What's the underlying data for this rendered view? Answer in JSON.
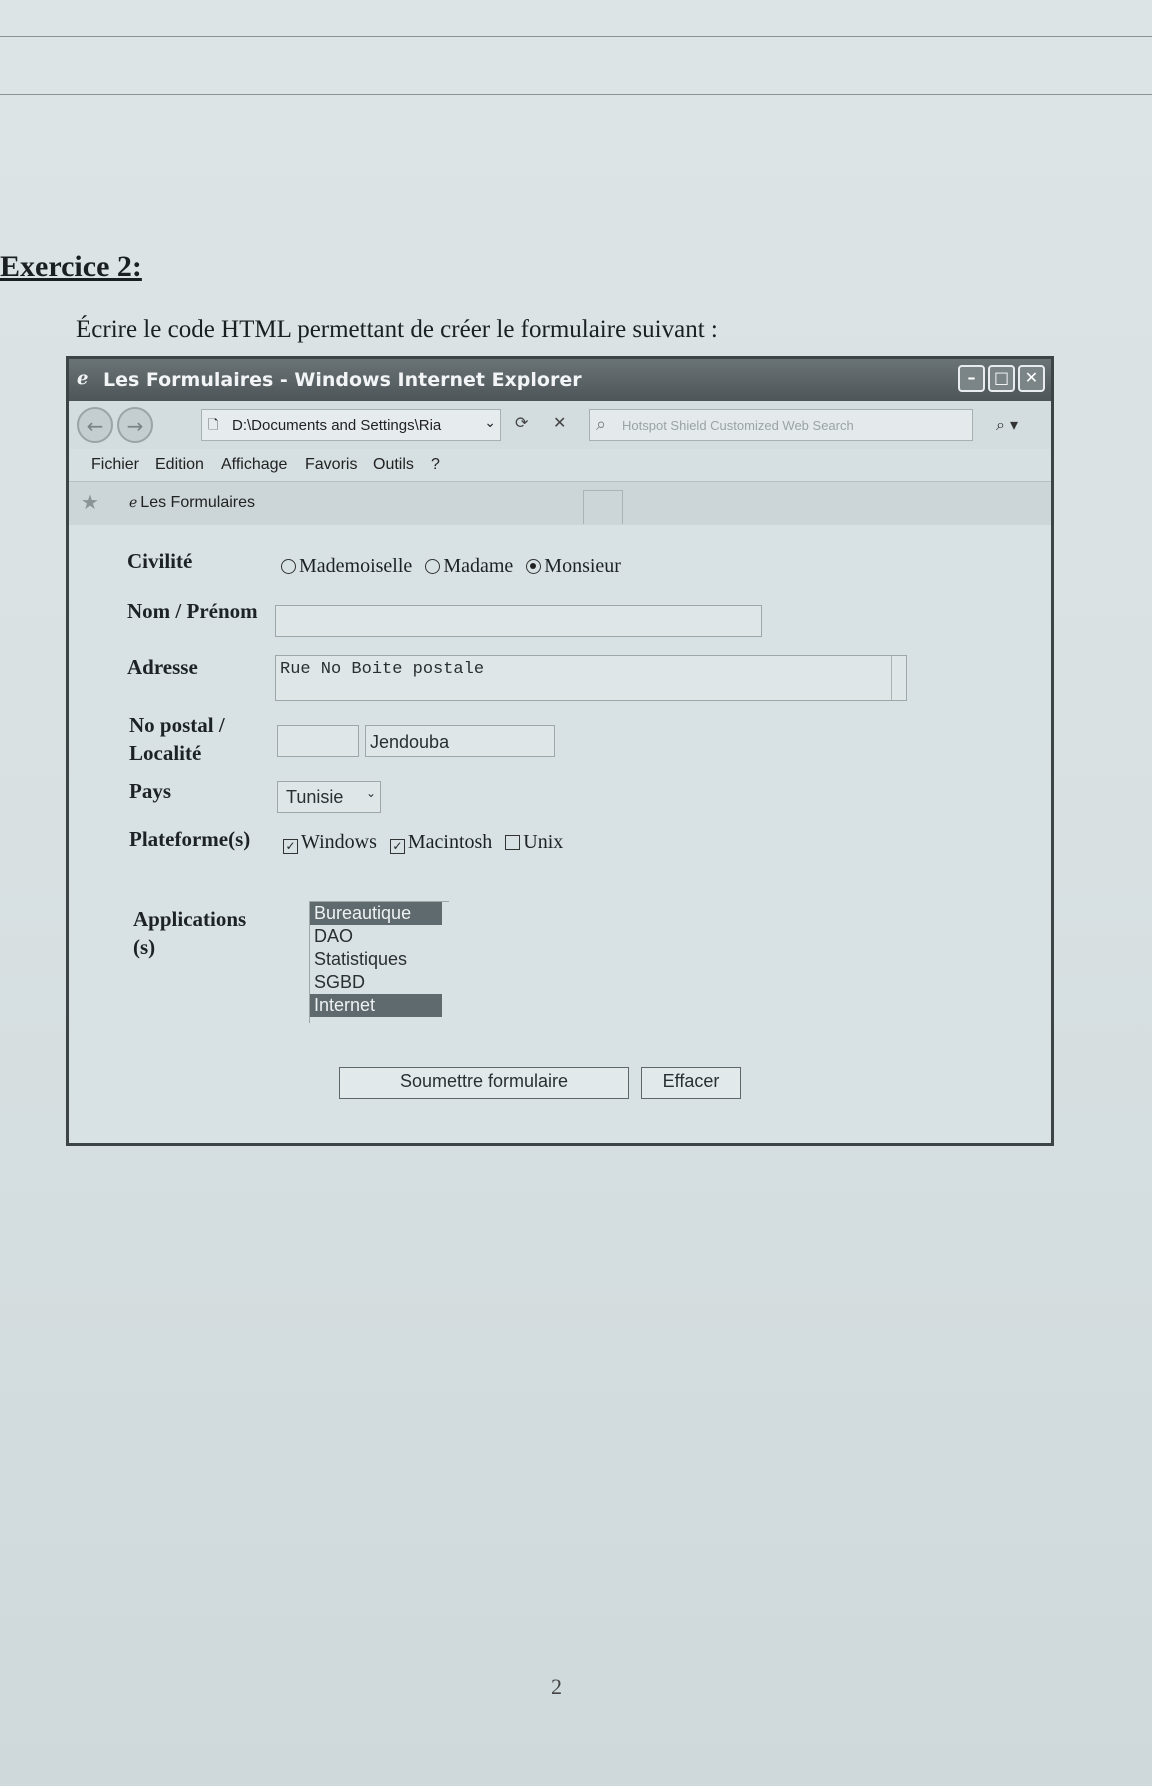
{
  "exercise": {
    "title": "Exercice 2:",
    "instruction": "Écrire le code HTML permettant de créer le formulaire suivant :"
  },
  "page_number": "2",
  "browser": {
    "window_title": "Les Formulaires - Windows Internet Explorer",
    "address": "D:\\Documents and Settings\\Ria",
    "search_placeholder": "Hotspot Shield Customized Web Search",
    "menu": [
      "Fichier",
      "Edition",
      "Affichage",
      "Favoris",
      "Outils",
      "?"
    ],
    "tab_title": "Les Formulaires"
  },
  "form": {
    "civilite": {
      "label": "Civilité",
      "options": [
        "Mademoiselle",
        "Madame",
        "Monsieur"
      ],
      "selected": "Monsieur"
    },
    "nom": {
      "label": "Nom / Prénom",
      "value": ""
    },
    "adresse": {
      "label": "Adresse",
      "value": "Rue No Boite postale"
    },
    "localite": {
      "label_line1": "No postal /",
      "label_line2": "Localité",
      "postal_value": "",
      "city_value": "Jendouba"
    },
    "pays": {
      "label": "Pays",
      "selected": "Tunisie"
    },
    "plateforme": {
      "label": "Plateforme(s)",
      "options": [
        {
          "label": "Windows",
          "checked": true
        },
        {
          "label": "Macintosh",
          "checked": true
        },
        {
          "label": "Unix",
          "checked": false
        }
      ]
    },
    "applications": {
      "label_line1": "Applications",
      "label_line2": "(s)",
      "items": [
        {
          "label": "Bureautique",
          "selected": true
        },
        {
          "label": "DAO",
          "selected": false
        },
        {
          "label": "Statistiques",
          "selected": false
        },
        {
          "label": "SGBD",
          "selected": false
        },
        {
          "label": "Internet",
          "selected": true
        }
      ]
    },
    "submit_label": "Soumettre formulaire",
    "reset_label": "Effacer"
  }
}
